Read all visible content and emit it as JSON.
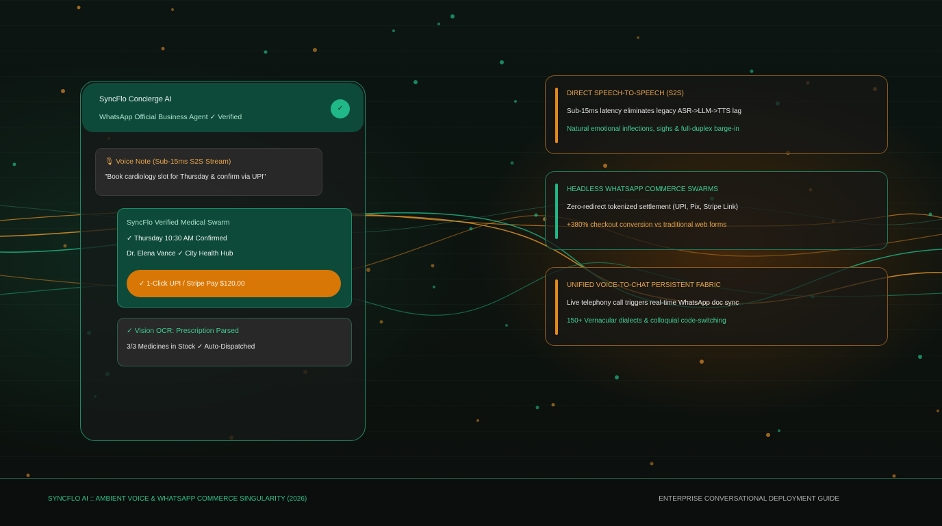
{
  "colors": {
    "accent_green": "#1fb886",
    "accent_orange": "#d97706",
    "panel_green": "#0e4a3a",
    "background": "#0d130f"
  },
  "chat": {
    "agent_name": "SyncFlo Concierge AI",
    "agent_status": "WhatsApp Official Business Agent ✓ Verified",
    "avatar_glyph": "✓",
    "voice_note": {
      "title": "🎙 Voice Note (Sub-15ms S2S Stream)",
      "transcript": "\"Book cardiology slot for Thursday & confirm via UPI\""
    },
    "medical": {
      "title": "SyncFlo Verified Medical Swarm",
      "line1": "✓ Thursday 10:30 AM Confirmed",
      "line2": "Dr. Elena Vance ✓ City Health Hub",
      "pay_button": "✓ 1-Click UPI / Stripe Pay $120.00"
    },
    "ocr": {
      "title": "✓ Vision OCR: Prescription Parsed",
      "status": "3/3 Medicines in Stock ✓ Auto-Dispatched"
    }
  },
  "features": [
    {
      "title": "DIRECT SPEECH-TO-SPEECH (S2S)",
      "line1": "Sub-15ms latency eliminates legacy ASR->LLM->TTS lag",
      "line2": "Natural emotional inflections, sighs & full-duplex barge-in",
      "accent": "#e8a54a",
      "highlight": "#3fcf98"
    },
    {
      "title": "HEADLESS WHATSAPP COMMERCE SWARMS",
      "line1": "Zero-redirect tokenized settlement (UPI, Pix, Stripe Link)",
      "line2": "+380% checkout conversion vs traditional web forms",
      "accent": "#3fcf98",
      "highlight": "#e8a54a"
    },
    {
      "title": "UNIFIED VOICE-TO-CHAT PERSISTENT FABRIC",
      "line1": "Live telephony call triggers real-time WhatsApp doc sync",
      "line2": "150+ Vernacular dialects & colloquial code-switching",
      "accent": "#e8a54a",
      "highlight": "#3fcf98"
    }
  ],
  "footer": {
    "left": "SYNCFLO AI :: AMBIENT VOICE & WHATSAPP COMMERCE SINGULARITY (2026)",
    "right": "ENTERPRISE CONVERSATIONAL DEPLOYMENT GUIDE"
  }
}
